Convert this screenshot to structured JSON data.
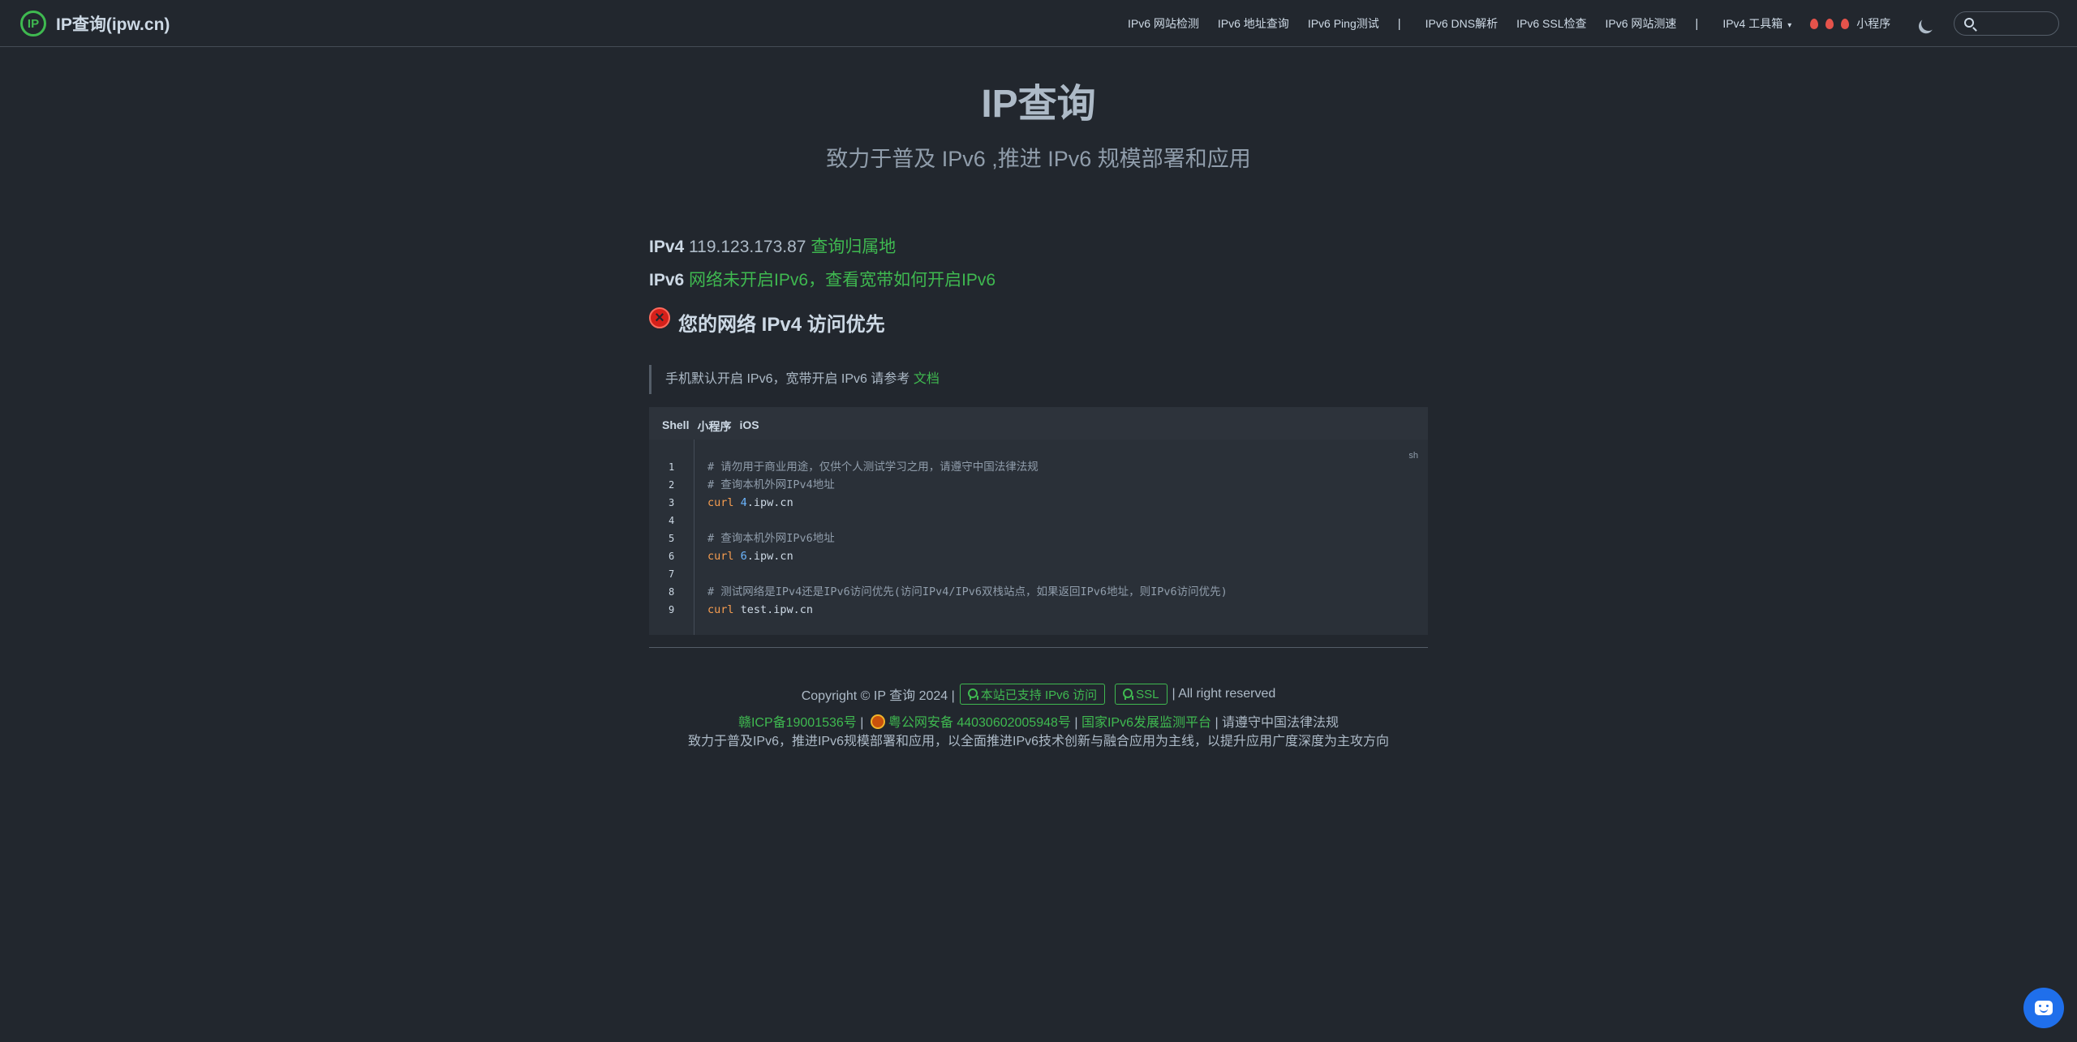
{
  "brand": {
    "logo_text": "IP",
    "title": "IP查询(ipw.cn)"
  },
  "nav": {
    "items": [
      "IPv6 网站检测",
      "IPv6 地址查询",
      "IPv6 Ping测试",
      "IPv6 DNS解析",
      "IPv6 SSL检查",
      "IPv6 网站测速",
      "IPv4 工具箱"
    ],
    "separator": "|",
    "caret": "▾",
    "miniprogram": "小程序",
    "search_placeholder": ""
  },
  "hero": {
    "title": "IP查询",
    "subtitle": "致力于普及 IPv6 ,推进 IPv6 规模部署和应用"
  },
  "ip": {
    "v4_label": "IPv4",
    "v4_address": "119.123.173.87",
    "v4_link": "查询归属地",
    "v6_label": "IPv6",
    "v6_status": "网络未开启IPv6，查看宽带如何开启IPv6"
  },
  "status": {
    "icon": "×",
    "text": "您的网络 IPv4 访问优先"
  },
  "note": {
    "text": "手机默认开启 IPv6，宽带开启 IPv6 请参考 ",
    "link": "文档"
  },
  "code": {
    "tabs": [
      "Shell",
      "小程序",
      "iOS"
    ],
    "lang": "sh",
    "lines": [
      {
        "n": "1",
        "comment": "# 请勿用于商业用途，仅供个人测试学习之用，请遵守中国法律法规"
      },
      {
        "n": "2",
        "comment": "# 查询本机外网IPv4地址"
      },
      {
        "n": "3",
        "cmd": "curl",
        "num": "4",
        "rest": ".ipw.cn"
      },
      {
        "n": "4"
      },
      {
        "n": "5",
        "comment": "# 查询本机外网IPv6地址"
      },
      {
        "n": "6",
        "cmd": "curl",
        "num": "6",
        "rest": ".ipw.cn"
      },
      {
        "n": "7"
      },
      {
        "n": "8",
        "comment": "# 测试网络是IPv4还是IPv6访问优先(访问IPv4/IPv6双栈站点，如果返回IPv6地址，则IPv6访问优先)"
      },
      {
        "n": "9",
        "cmd": "curl",
        "num": "",
        "rest": "test.ipw.cn"
      }
    ]
  },
  "footer": {
    "copyright": "Copyright © IP 查询 2024 |",
    "badge_ipv6": "本站已支持 IPv6 访问",
    "badge_ssl": "SSL",
    "rights": "| All right reserved",
    "icp": "赣ICP备19001536号",
    "sep": "|",
    "police": "粤公网安备 44030602005948号",
    "platform": "国家IPv6发展监测平台",
    "law": "| 请遵守中国法律法规",
    "mission": "致力于普及IPv6，推进IPv6规模部署和应用，以全面推进IPv6技术创新与融合应用为主线，以提升应用广度深度为主攻方向"
  },
  "colors": {
    "background": "#22272e",
    "accent": "#3fb950",
    "chat": "#1f6feb",
    "error": "#d5201a"
  }
}
